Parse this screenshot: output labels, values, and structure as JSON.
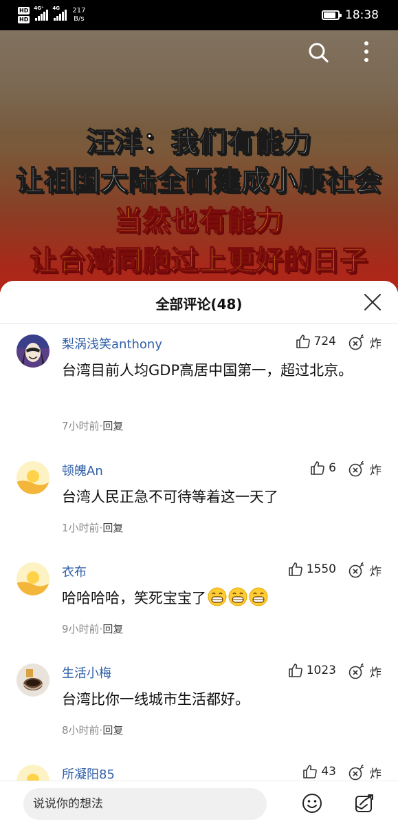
{
  "status_bar": {
    "hd1": "HD",
    "hd2": "HD",
    "net1": "4G⁺",
    "net2": "4G",
    "speed_value": "217",
    "speed_unit": "B/s",
    "time": "18:38",
    "battery_level": 0.85
  },
  "video": {
    "line1": "汪洋：我们有能力",
    "line2": "让祖国大陆全面建成小康社会",
    "line3": "当然也有能力",
    "line4": "让台湾同胞过上更好的日子"
  },
  "comments_panel": {
    "title": "全部评论(48)"
  },
  "comments": [
    {
      "user": "梨涡浅笑anthony",
      "likes": "724",
      "bomb": "炸",
      "text": "台湾目前人均GDP高居中国第一，超过北京。",
      "time": "7小时前",
      "reply": "回复"
    },
    {
      "user": "顿魄An",
      "likes": "6",
      "bomb": "炸",
      "text": "台湾人民正急不可待等着这一天了",
      "time": "1小时前",
      "reply": "回复"
    },
    {
      "user": "衣布",
      "likes": "1550",
      "bomb": "炸",
      "text": "哈哈哈哈，笑死宝宝了",
      "time": "9小时前",
      "reply": "回复"
    },
    {
      "user": "生活小梅",
      "likes": "1023",
      "bomb": "炸",
      "text": "台湾比你一线城市生活都好。",
      "time": "8小时前",
      "reply": "回复"
    },
    {
      "user": "所凝阳85",
      "likes": "43",
      "bomb": "炸"
    }
  ],
  "bottom_bar": {
    "placeholder": "说说你的想法"
  },
  "icons": {
    "search": "search-icon",
    "more": "more-vertical-icon",
    "close": "close-icon",
    "like": "thumbs-up-icon",
    "bomb": "bomb-icon",
    "emoji": "smiley-icon",
    "share": "share-icon",
    "grin": "grin-emoji"
  }
}
